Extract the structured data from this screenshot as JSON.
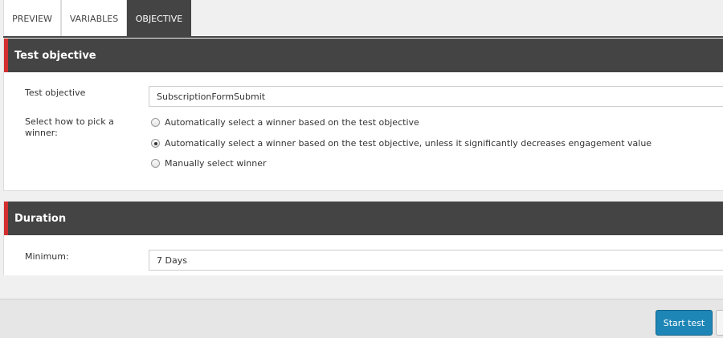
{
  "tabs": [
    {
      "label": "PREVIEW",
      "active": false
    },
    {
      "label": "VARIABLES",
      "active": false
    },
    {
      "label": "OBJECTIVE",
      "active": true
    }
  ],
  "objective_section": {
    "title": "Test objective",
    "objective_label": "Test objective",
    "objective_value": "SubscriptionFormSubmit",
    "winner_label": "Select how to pick a winner:",
    "winner_options": [
      {
        "label": "Automatically select a winner based on the test objective",
        "checked": false
      },
      {
        "label": "Automatically select a winner based on the test objective, unless it significantly decreases engagement value",
        "checked": true
      },
      {
        "label": "Manually select winner",
        "checked": false
      }
    ]
  },
  "duration_section": {
    "title": "Duration",
    "minimum_label": "Minimum:",
    "minimum_value": "7 Days"
  },
  "footer": {
    "start_label": "Start test"
  },
  "colors": {
    "header_bg": "#444444",
    "accent": "#d32f2f",
    "primary_button": "#1e86b6"
  }
}
